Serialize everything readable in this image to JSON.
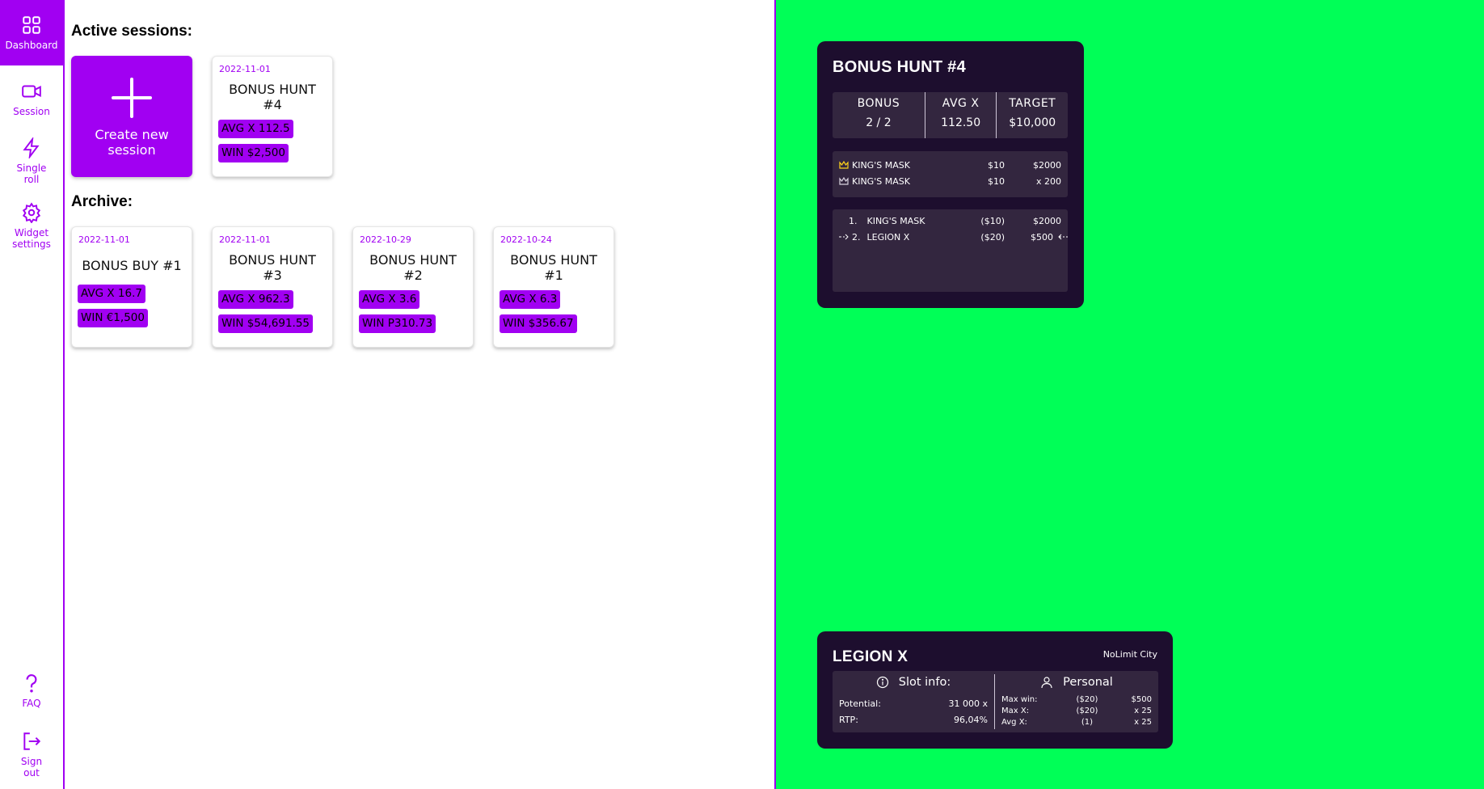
{
  "sidebar": {
    "items": [
      {
        "label": "Dashboard",
        "icon": "grid-icon"
      },
      {
        "label": "Session",
        "icon": "video-camera-icon"
      },
      {
        "label": "Single\nroll",
        "icon": "lightning-icon"
      },
      {
        "label": "Widget\nsettings",
        "icon": "gear-icon"
      },
      {
        "label": "FAQ",
        "icon": "question-icon"
      },
      {
        "label": "Sign\nout",
        "icon": "sign-out-icon"
      }
    ]
  },
  "main": {
    "active_title": "Active sessions:",
    "archive_title": "Archive:",
    "create_label": "Create new session",
    "active": [
      {
        "date": "2022-11-01",
        "title": "BONUS HUNT #4",
        "avg": "AVG X 112.5",
        "win": "WIN $2,500"
      }
    ],
    "archive": [
      {
        "date": "2022-11-01",
        "title": "BONUS BUY #1",
        "avg": "AVG X 16.7",
        "win": "WIN €1,500"
      },
      {
        "date": "2022-11-01",
        "title": "BONUS HUNT #3",
        "avg": "AVG X 962.3",
        "win": "WIN $54,691.55"
      },
      {
        "date": "2022-10-29",
        "title": "BONUS HUNT #2",
        "avg": "AVG X 3.6",
        "win": "WIN P310.73"
      },
      {
        "date": "2022-10-24",
        "title": "BONUS HUNT #1",
        "avg": "AVG X 6.3",
        "win": "WIN $356.67"
      }
    ]
  },
  "hunt_widget": {
    "title": "BONUS HUNT #4",
    "stats": [
      {
        "key": "BONUS",
        "value": "2 / 2"
      },
      {
        "key": "AVG X",
        "value": "112.50"
      },
      {
        "key": "TARGET",
        "value": "$10,000"
      }
    ],
    "top": [
      {
        "name": "KING'S MASK",
        "bet": "$10",
        "win": "$2000",
        "icon": "crown-gold-icon"
      },
      {
        "name": "KING'S MASK",
        "bet": "$10",
        "win": "x 200",
        "icon": "crown-outline-icon"
      }
    ],
    "list": [
      {
        "num": "1.",
        "name": "KING'S MASK",
        "bet": "($10)",
        "win": "$2000",
        "current": false
      },
      {
        "num": "2.",
        "name": "LEGION X",
        "bet": "($20)",
        "win": "$500",
        "current": true
      }
    ]
  },
  "slot_widget": {
    "title": "LEGION X",
    "provider": "NoLimit City",
    "slot_info_label": "Slot info:",
    "personal_label": "Personal",
    "slot_info": [
      {
        "key": "Potential:",
        "value": "31 000 x"
      },
      {
        "key": "RTP:",
        "value": "96,04%"
      }
    ],
    "personal": [
      {
        "key": "Max win:",
        "bet": "($20)",
        "value": "$500"
      },
      {
        "key": "Max X:",
        "bet": "($20)",
        "value": "x 25"
      },
      {
        "key": "Avg X:",
        "bet": "(1)",
        "value": "x 25"
      }
    ]
  },
  "colors": {
    "accent": "#a100f2",
    "green": "#00ff57",
    "widget_bg": "#1d0e2e",
    "panel_bg": "#33263f"
  }
}
